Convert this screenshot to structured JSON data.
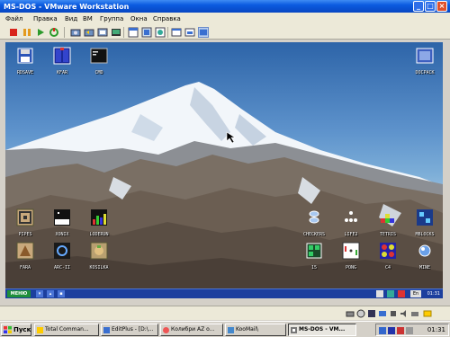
{
  "window": {
    "title": "MS-DOS - VMware Workstation",
    "controls": {
      "minimize": "_",
      "maximize": "□",
      "close": "×"
    }
  },
  "menu": [
    "Файл",
    "Правка",
    "Вид",
    "ВМ",
    "Группа",
    "Окна",
    "Справка"
  ],
  "toolbar": [
    "stop-icon",
    "pause-icon",
    "play-icon",
    "reset-icon",
    "snapshot-icon",
    "revert-icon",
    "manage-snapshots-icon",
    "console-icon",
    "summary-icon",
    "fullscreen-icon",
    "quickswitch-icon",
    "unity-icon",
    "view-icon"
  ],
  "desktop": {
    "top_icons": [
      {
        "label": "RDSAVE",
        "icon": "floppy-icon"
      },
      {
        "label": "KFAR",
        "icon": "kfar-icon"
      },
      {
        "label": "CMD",
        "icon": "terminal-icon"
      },
      {
        "label": "DOCPACK",
        "icon": "docpack-icon"
      }
    ],
    "left_icons": [
      {
        "label": "PIPES",
        "icon": "pipes-icon"
      },
      {
        "label": "XONIX",
        "icon": "xonix-icon"
      },
      {
        "label": "LODERUN",
        "icon": "loderun-icon"
      },
      {
        "label": "FARA",
        "icon": "fara-icon"
      },
      {
        "label": "ARC-II",
        "icon": "arc-icon"
      },
      {
        "label": "KOSILKA",
        "icon": "kosilka-icon"
      }
    ],
    "right_icons": [
      {
        "label": "CHECKERS",
        "icon": "checkers-icon"
      },
      {
        "label": "LIFE2",
        "icon": "life-icon"
      },
      {
        "label": "TETRIS",
        "icon": "tetris-icon"
      },
      {
        "label": "MBLOCKS",
        "icon": "mblocks-icon"
      },
      {
        "label": "15",
        "icon": "fifteen-icon"
      },
      {
        "label": "PONG",
        "icon": "pong-icon"
      },
      {
        "label": "C4",
        "icon": "c4-icon"
      },
      {
        "label": "MINE",
        "icon": "mine-icon"
      }
    ]
  },
  "guest_taskbar": {
    "menu_label": "МЕНЮ",
    "lang": "En",
    "clock": "01:31"
  },
  "taskbar": {
    "start_label": "Пуск",
    "tasks": [
      {
        "label": "Total Comman...",
        "active": false
      },
      {
        "label": "EditPlus - [D:\\...",
        "active": false
      },
      {
        "label": "Колибри AZ о...",
        "active": false
      },
      {
        "label": "KooMail\\",
        "active": false
      },
      {
        "label": "MS-DOS - VM...",
        "active": true
      }
    ],
    "lang": "En",
    "clock": "01:31"
  },
  "colors": {
    "titlebar": "#0a5ae0",
    "guest_taskbar": "#1c3f9e",
    "menu_button": "#1f8f3a"
  }
}
